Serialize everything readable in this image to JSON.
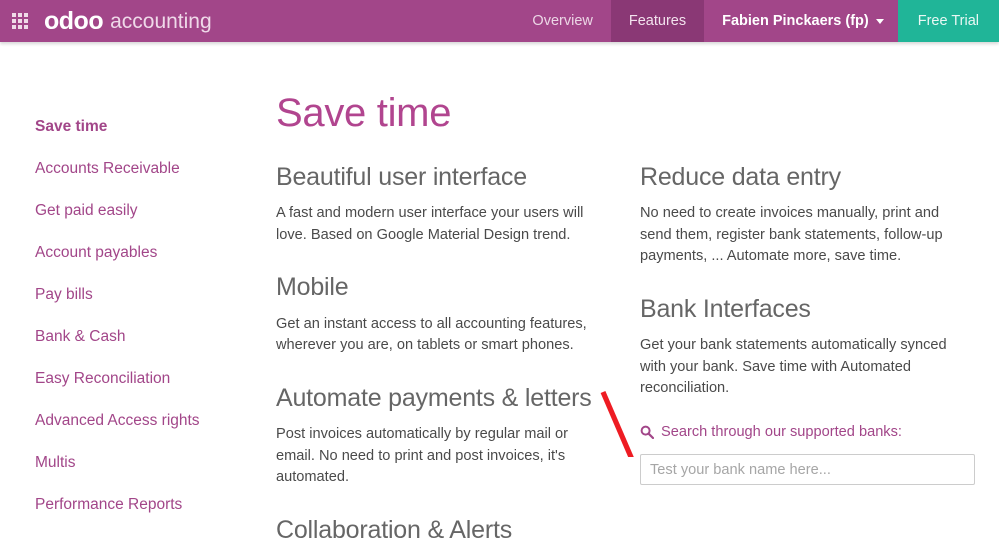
{
  "navbar": {
    "apps_icon": "apps-grid-icon",
    "brand_logo": "odoo",
    "brand_suffix": "accounting",
    "links": [
      {
        "label": "Overview",
        "name": "nav-link-overview",
        "active": false
      },
      {
        "label": "Features",
        "name": "nav-link-features",
        "active": true
      }
    ],
    "user_menu": "Fabien Pinckaers (fp)",
    "trial_button": "Free Trial",
    "colors": {
      "bar": "#a24689",
      "active_tab": "#8a3875",
      "trial": "#20b598"
    }
  },
  "sidebar": {
    "items": [
      {
        "label": "Save time",
        "active": true
      },
      {
        "label": "Accounts Receivable",
        "active": false
      },
      {
        "label": "Get paid easily",
        "active": false
      },
      {
        "label": "Account payables",
        "active": false
      },
      {
        "label": "Pay bills",
        "active": false
      },
      {
        "label": "Bank & Cash",
        "active": false
      },
      {
        "label": "Easy Reconciliation",
        "active": false
      },
      {
        "label": "Advanced Access rights",
        "active": false
      },
      {
        "label": "Multis",
        "active": false
      },
      {
        "label": "Performance Reports",
        "active": false
      }
    ]
  },
  "main": {
    "title": "Save time",
    "left_column": [
      {
        "heading": "Beautiful user interface",
        "body": "A fast and modern user interface your users will love. Based on Google Material Design trend."
      },
      {
        "heading": "Mobile",
        "body": "Get an instant access to all accounting features, wherever you are, on tablets or smart phones."
      },
      {
        "heading": "Automate payments & letters",
        "body": "Post invoices automatically by regular mail or email. No need to print and post invoices, it's automated."
      },
      {
        "heading": "Collaboration & Alerts",
        "body": ""
      }
    ],
    "right_column": [
      {
        "heading": "Reduce data entry",
        "body": "No need to create invoices manually, print and send them, register bank statements, follow-up payments, ... Automate more, save time."
      },
      {
        "heading": "Bank Interfaces",
        "body": "Get your bank statements automatically synced with your bank. Save time with Automated reconciliation."
      }
    ],
    "bank_search": {
      "link_label": "Search through our supported banks:",
      "icon": "search-icon",
      "input_value": "",
      "input_placeholder": "Test your bank name here..."
    }
  },
  "annotation": {
    "type": "red-arrow",
    "color": "#ee1c23",
    "points_to": "bank-search-input"
  }
}
